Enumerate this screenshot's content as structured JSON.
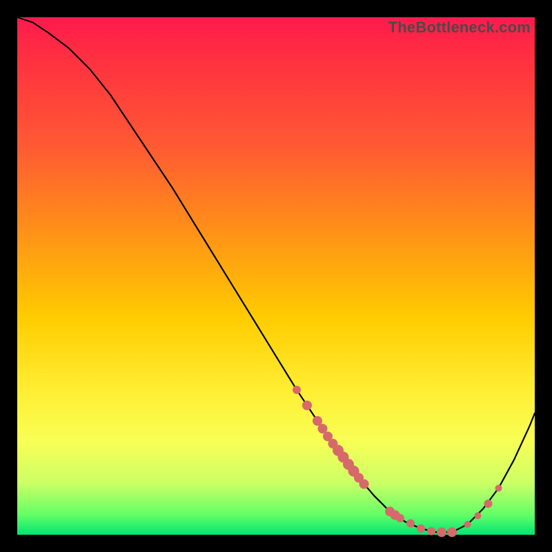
{
  "watermark": "TheBottleneck.com",
  "colors": {
    "top": "#ff1a4d",
    "bottom": "#00e673",
    "curve": "#000000",
    "marker": "#d66a6a",
    "background": "#000000"
  },
  "chart_data": {
    "type": "line",
    "title": "",
    "xlabel": "",
    "ylabel": "",
    "xlim": [
      0,
      100
    ],
    "ylim": [
      0,
      100
    ],
    "x": [
      0,
      3,
      6,
      10,
      14,
      18,
      22,
      26,
      30,
      34,
      38,
      42,
      46,
      50,
      54,
      58,
      60,
      63,
      66,
      69,
      72,
      75,
      78,
      81,
      84,
      87,
      90,
      93,
      96,
      99,
      100
    ],
    "y": [
      100,
      99,
      97,
      94,
      90,
      85,
      79,
      73,
      67,
      60.5,
      54,
      47.5,
      41,
      34.5,
      28,
      22,
      19,
      15,
      11,
      7.5,
      4.5,
      2.5,
      1.2,
      0.5,
      0.5,
      2.0,
      5.0,
      9.0,
      14.5,
      21,
      23.5
    ],
    "markers": {
      "x": [
        54,
        56,
        58,
        59,
        60,
        61,
        62,
        63,
        64,
        65,
        66,
        67,
        72,
        73,
        74,
        76,
        78,
        80,
        82,
        84,
        87,
        89,
        91,
        93
      ],
      "y": [
        28,
        25,
        22,
        20.5,
        19,
        17.6,
        16.3,
        15,
        13.6,
        12.3,
        11,
        9.8,
        4.5,
        3.8,
        3.2,
        2.2,
        1.2,
        0.7,
        0.5,
        0.5,
        2.0,
        3.7,
        6.0,
        9.0
      ],
      "r": [
        6,
        7,
        7,
        7,
        7,
        7,
        8,
        8,
        8,
        8,
        7,
        7,
        7,
        7,
        6,
        6,
        6,
        6,
        7,
        7,
        5,
        5,
        6,
        5
      ]
    },
    "note": "y represents bottleneck percentage (100 = worst at top, 0 = best at bottom); the minimum sits around x≈82."
  }
}
